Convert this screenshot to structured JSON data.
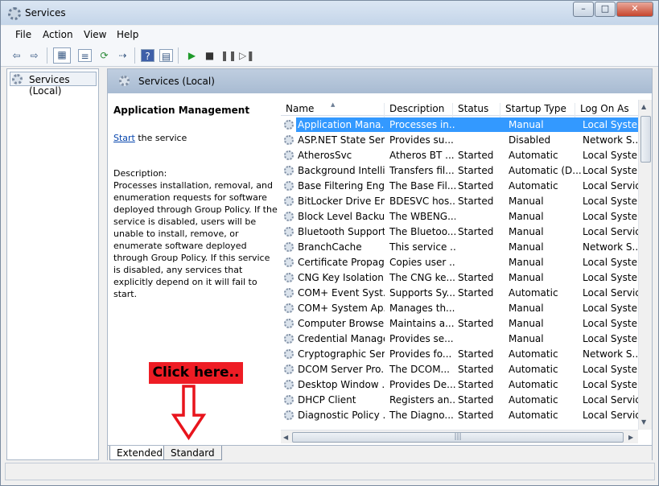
{
  "window": {
    "title": "Services"
  },
  "controls": {
    "minimize": "–",
    "maximize": "□",
    "close": "✕"
  },
  "menu": [
    "File",
    "Action",
    "View",
    "Help"
  ],
  "tree": {
    "root": "Services (Local)"
  },
  "header": {
    "title": "Services (Local)"
  },
  "detail": {
    "title": "Application Management",
    "start_link": "Start",
    "start_suffix": " the service",
    "description_label": "Description:",
    "description": "Processes installation, removal, and enumeration requests for software deployed through Group Policy. If the service is disabled, users will be unable to install, remove, or enumerate software deployed through Group Policy. If this service is disabled, any services that explicitly depend on it will fail to start."
  },
  "columns": [
    "Name",
    "Description",
    "Status",
    "Startup Type",
    "Log On As"
  ],
  "rows": [
    {
      "name": "Application Mana...",
      "desc": "Processes in...",
      "status": "",
      "startup": "Manual",
      "logon": "Local Syste..."
    },
    {
      "name": "ASP.NET State Ser...",
      "desc": "Provides su...",
      "status": "",
      "startup": "Disabled",
      "logon": "Network S..."
    },
    {
      "name": "AtherosSvc",
      "desc": "Atheros BT ...",
      "status": "Started",
      "startup": "Automatic",
      "logon": "Local Syste..."
    },
    {
      "name": "Background Intelli...",
      "desc": "Transfers fil...",
      "status": "Started",
      "startup": "Automatic (D...",
      "logon": "Local Syste..."
    },
    {
      "name": "Base Filtering Engi...",
      "desc": "The Base Fil...",
      "status": "Started",
      "startup": "Automatic",
      "logon": "Local Service"
    },
    {
      "name": "BitLocker Drive En...",
      "desc": "BDESVC hos...",
      "status": "Started",
      "startup": "Manual",
      "logon": "Local Syste..."
    },
    {
      "name": "Block Level Backu...",
      "desc": "The WBENG...",
      "status": "",
      "startup": "Manual",
      "logon": "Local Syste..."
    },
    {
      "name": "Bluetooth Support...",
      "desc": "The Bluetoo...",
      "status": "Started",
      "startup": "Manual",
      "logon": "Local Service"
    },
    {
      "name": "BranchCache",
      "desc": "This service ...",
      "status": "",
      "startup": "Manual",
      "logon": "Network S..."
    },
    {
      "name": "Certificate Propag...",
      "desc": "Copies user ...",
      "status": "",
      "startup": "Manual",
      "logon": "Local Syste..."
    },
    {
      "name": "CNG Key Isolation",
      "desc": "The CNG ke...",
      "status": "Started",
      "startup": "Manual",
      "logon": "Local Syste..."
    },
    {
      "name": "COM+ Event Syst...",
      "desc": "Supports Sy...",
      "status": "Started",
      "startup": "Automatic",
      "logon": "Local Service"
    },
    {
      "name": "COM+ System Ap...",
      "desc": "Manages th...",
      "status": "",
      "startup": "Manual",
      "logon": "Local Syste..."
    },
    {
      "name": "Computer Browser",
      "desc": "Maintains a...",
      "status": "Started",
      "startup": "Manual",
      "logon": "Local Syste..."
    },
    {
      "name": "Credential Manager",
      "desc": "Provides se...",
      "status": "",
      "startup": "Manual",
      "logon": "Local Syste..."
    },
    {
      "name": "Cryptographic Ser...",
      "desc": "Provides fo...",
      "status": "Started",
      "startup": "Automatic",
      "logon": "Network S..."
    },
    {
      "name": "DCOM Server Pro...",
      "desc": "The DCOM...",
      "status": "Started",
      "startup": "Automatic",
      "logon": "Local Syste..."
    },
    {
      "name": "Desktop Window ...",
      "desc": "Provides De...",
      "status": "Started",
      "startup": "Automatic",
      "logon": "Local Syste..."
    },
    {
      "name": "DHCP Client",
      "desc": "Registers an...",
      "status": "Started",
      "startup": "Automatic",
      "logon": "Local Service"
    },
    {
      "name": "Diagnostic Policy ...",
      "desc": "The Diagno...",
      "status": "Started",
      "startup": "Automatic",
      "logon": "Local Service"
    }
  ],
  "tabs": [
    "Extended",
    "Standard"
  ],
  "callout": "Click here..",
  "colors": {
    "selection": "#3399ff",
    "callout": "#ee1c24",
    "arrow": "#e8141c"
  }
}
